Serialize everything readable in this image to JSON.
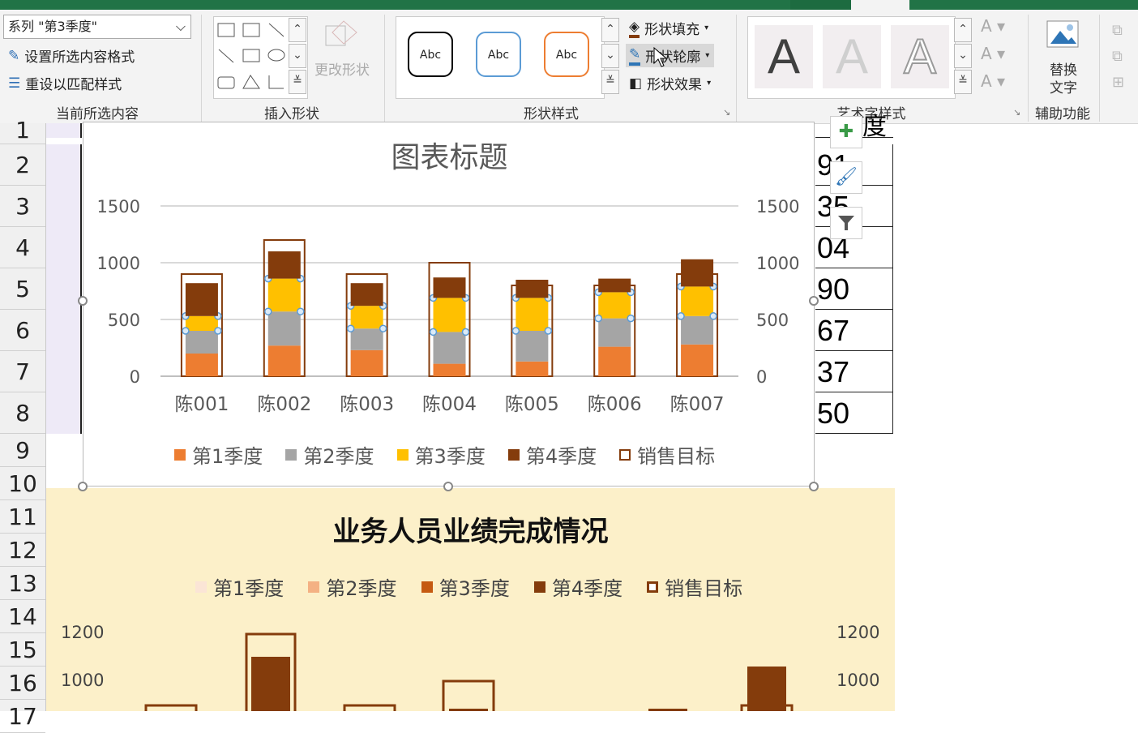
{
  "ribbon": {
    "current_selection": {
      "dropdown_value": "系列 \"第3季度\"",
      "format_selection": "设置所选内容格式",
      "reset_style": "重设以匹配样式",
      "group_label": "当前所选内容"
    },
    "insert_shapes": {
      "edit_shape": "更改形状",
      "group_label": "插入形状"
    },
    "shape_styles": {
      "presets": [
        "Abc",
        "Abc",
        "Abc"
      ],
      "fill": "形状填充",
      "outline": "形状轮廓",
      "effects": "形状效果",
      "group_label": "形状样式"
    },
    "wordart": {
      "group_label": "艺术字样式",
      "letters": [
        "A",
        "A",
        "A"
      ]
    },
    "accessibility": {
      "alt_text": "替换",
      "alt_text2": "文字",
      "group_label": "辅助功能"
    }
  },
  "sheet": {
    "row_numbers": [
      "1",
      "2",
      "3",
      "4",
      "5",
      "6",
      "7",
      "8",
      "9",
      "10",
      "11",
      "12",
      "13",
      "14",
      "15",
      "16",
      "17"
    ],
    "right_col_header_partial": "度",
    "right_col_values": [
      "91",
      "35",
      "04",
      "90",
      "67",
      "37",
      "50"
    ]
  },
  "chart1": {
    "title": "图表标题",
    "chart_data": {
      "type": "bar",
      "title": "图表标题",
      "categories": [
        "陈001",
        "陈002",
        "陈003",
        "陈004",
        "陈005",
        "陈006",
        "陈007"
      ],
      "series": [
        {
          "name": "第1季度",
          "values": [
            200,
            270,
            230,
            110,
            130,
            260,
            280
          ]
        },
        {
          "name": "第2季度",
          "values": [
            200,
            300,
            190,
            280,
            270,
            250,
            250
          ]
        },
        {
          "name": "第3季度",
          "values": [
            130,
            290,
            200,
            300,
            290,
            230,
            260
          ]
        },
        {
          "name": "第4季度",
          "values": [
            290,
            240,
            200,
            180,
            160,
            120,
            240
          ]
        },
        {
          "name": "销售目标",
          "values": [
            900,
            1200,
            900,
            1000,
            800,
            800,
            900
          ]
        }
      ],
      "yticks": [
        "0",
        "500",
        "1000",
        "1500"
      ],
      "ylim": [
        0,
        1500
      ],
      "colors": [
        "#ed7d31",
        "#a5a5a5",
        "#ffc000",
        "#843c0c",
        "#ffffff"
      ],
      "legend_position": "bottom"
    }
  },
  "chart2": {
    "title": "业务人员业绩完成情况",
    "legend": [
      "第1季度",
      "第2季度",
      "第3季度",
      "第4季度",
      "销售目标"
    ],
    "legend_colors": [
      "#fbe5d6",
      "#f4b183",
      "#c55a11",
      "#843c0c",
      "#ffffff"
    ],
    "yticks_visible": [
      "1200",
      "1000"
    ]
  }
}
